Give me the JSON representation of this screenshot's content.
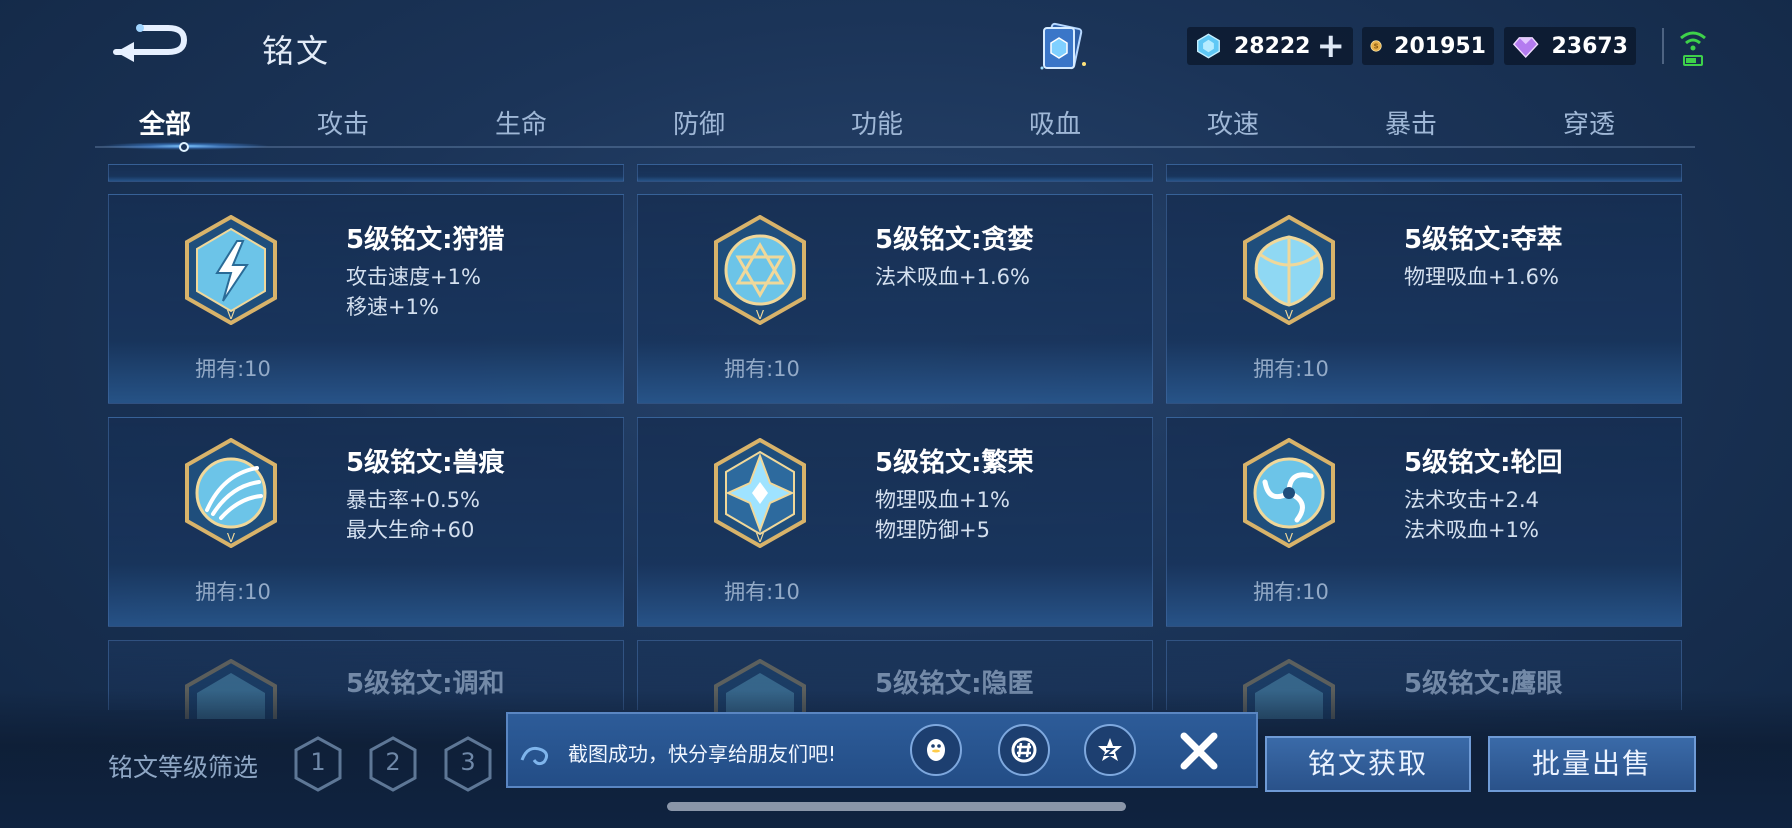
{
  "header": {
    "title": "铭文",
    "currencies": [
      {
        "icon": "diamond-icon",
        "value": "28222",
        "color": "#5fc8f5"
      },
      {
        "icon": "gold-coin-icon",
        "value": "201951",
        "color": "#e9b14a"
      },
      {
        "icon": "gem-icon",
        "value": "23673",
        "color": "#b47cf0"
      }
    ]
  },
  "tabs": [
    "全部",
    "攻击",
    "生命",
    "防御",
    "功能",
    "吸血",
    "攻速",
    "暴击",
    "穿透"
  ],
  "active_tab": "全部",
  "cards": [
    {
      "name": "5级铭文:狩猎",
      "stats": [
        "攻击速度+1%",
        "移速+1%"
      ],
      "owned": "拥有:10",
      "icon": "lightning-rune-icon"
    },
    {
      "name": "5级铭文:贪婪",
      "stats": [
        "法术吸血+1.6%"
      ],
      "owned": "拥有:10",
      "icon": "star-rune-icon"
    },
    {
      "name": "5级铭文:夺萃",
      "stats": [
        "物理吸血+1.6%"
      ],
      "owned": "拥有:10",
      "icon": "leaf-rune-icon"
    },
    {
      "name": "5级铭文:兽痕",
      "stats": [
        "暴击率+0.5%",
        "最大生命+60"
      ],
      "owned": "拥有:10",
      "icon": "claw-rune-icon"
    },
    {
      "name": "5级铭文:繁荣",
      "stats": [
        "物理吸血+1%",
        "物理防御+5"
      ],
      "owned": "拥有:10",
      "icon": "crystal-rune-icon"
    },
    {
      "name": "5级铭文:轮回",
      "stats": [
        "法术攻击+2.4",
        "法术吸血+1%"
      ],
      "owned": "拥有:10",
      "icon": "swirl-rune-icon"
    }
  ],
  "partial_cards": [
    {
      "name": "5级铭文:调和"
    },
    {
      "name": "5级铭文:隐匿"
    },
    {
      "name": "5级铭文:鹰眼"
    }
  ],
  "filter": {
    "label": "铭文等级筛选",
    "levels": [
      "1",
      "2",
      "3"
    ]
  },
  "buttons": {
    "get": "铭文获取",
    "sell": "批量出售"
  },
  "toast": {
    "message": "截图成功，快分享给朋友们吧!"
  }
}
